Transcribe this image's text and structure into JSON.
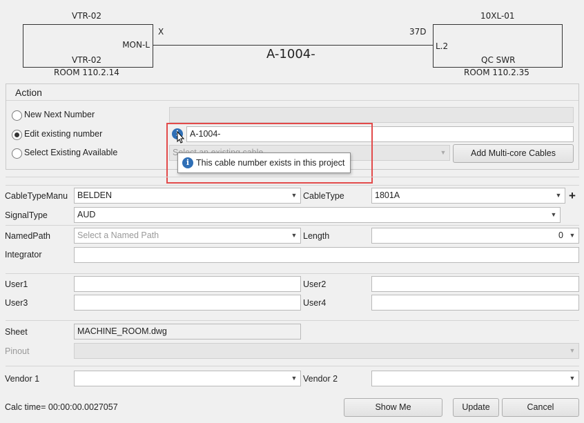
{
  "diagram": {
    "left_node": {
      "top_label": "VTR-02",
      "port": "MON-L",
      "inner_label": "VTR-02",
      "room": "ROOM 110.2.14",
      "connector": "X"
    },
    "right_node": {
      "top_label": "10XL-01",
      "port": "L.2",
      "inner_label": "QC SWR",
      "room": "ROOM 110.2.35",
      "connector": "37D"
    },
    "cable_label": "A-1004-"
  },
  "action": {
    "title": "Action",
    "options": [
      {
        "label": "New Next Number",
        "selected": false
      },
      {
        "label": "Edit existing number",
        "selected": true
      },
      {
        "label": "Select Existing Available",
        "selected": false
      }
    ],
    "edit_value": "A-1004-",
    "select_placeholder": "Select an existing cable",
    "add_multicore_label": "Add Multi-core Cables",
    "tooltip": "This cable number exists in this project"
  },
  "form": {
    "cable_type_manu_label": "CableTypeManu",
    "cable_type_manu_value": "BELDEN",
    "cable_type_label": "CableType",
    "cable_type_value": "1801A",
    "signal_type_label": "SignalType",
    "signal_type_value": "AUD",
    "named_path_label": "NamedPath",
    "named_path_placeholder": "Select a Named Path",
    "length_label": "Length",
    "length_value": "0",
    "integrator_label": "Integrator",
    "user1_label": "User1",
    "user2_label": "User2",
    "user3_label": "User3",
    "user4_label": "User4",
    "sheet_label": "Sheet",
    "sheet_value": "MACHINE_ROOM.dwg",
    "pinout_label": "Pinout",
    "vendor1_label": "Vendor 1",
    "vendor2_label": "Vendor 2"
  },
  "footer": {
    "calc_time": "Calc time= 00:00:00.0027057",
    "show_me_label": "Show Me",
    "update_label": "Update",
    "cancel_label": "Cancel"
  },
  "colors": {
    "highlight": "#e24a4a",
    "info": "#2f6fb6"
  }
}
